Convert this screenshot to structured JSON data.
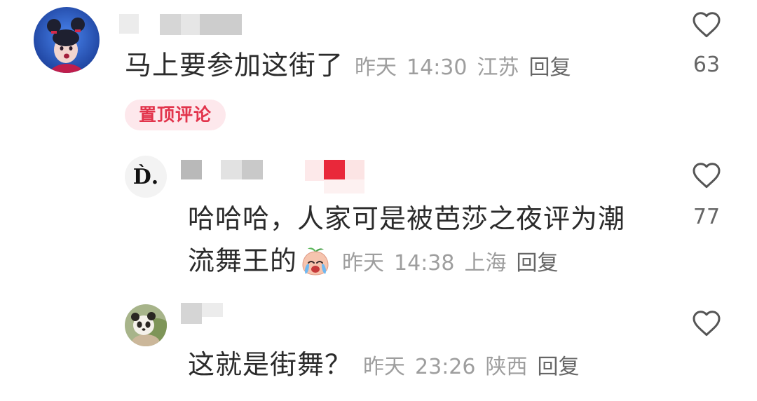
{
  "top_comment": {
    "text": "马上要参加这街了",
    "meta": {
      "date": "昨天",
      "time": "14:30",
      "location": "江苏",
      "reply": "回复"
    },
    "like_icon": "heart-icon",
    "like_count": "63",
    "pinned_badge": "置顶评论"
  },
  "replies": [
    {
      "avatar_text": "D̀.",
      "text": "哈哈哈，人家可是被芭莎之夜评为潮流舞王的",
      "emoji_icon": "crying-emoji-icon",
      "meta": {
        "date": "昨天",
        "time": "14:38",
        "location": "上海",
        "reply": "回复"
      },
      "like_icon": "heart-icon",
      "like_count": "77"
    },
    {
      "text": "这就是街舞？",
      "meta": {
        "date": "昨天",
        "time": "23:26",
        "location": "陕西",
        "reply": "回复"
      },
      "like_icon": "heart-icon"
    }
  ],
  "colors": {
    "text": "#2b2b2b",
    "meta": "#9e9e9e",
    "reply": "#666666",
    "count": "#666666",
    "icon": "#555555",
    "badge_bg": "#fde8ec",
    "badge_text": "#e2344c"
  }
}
